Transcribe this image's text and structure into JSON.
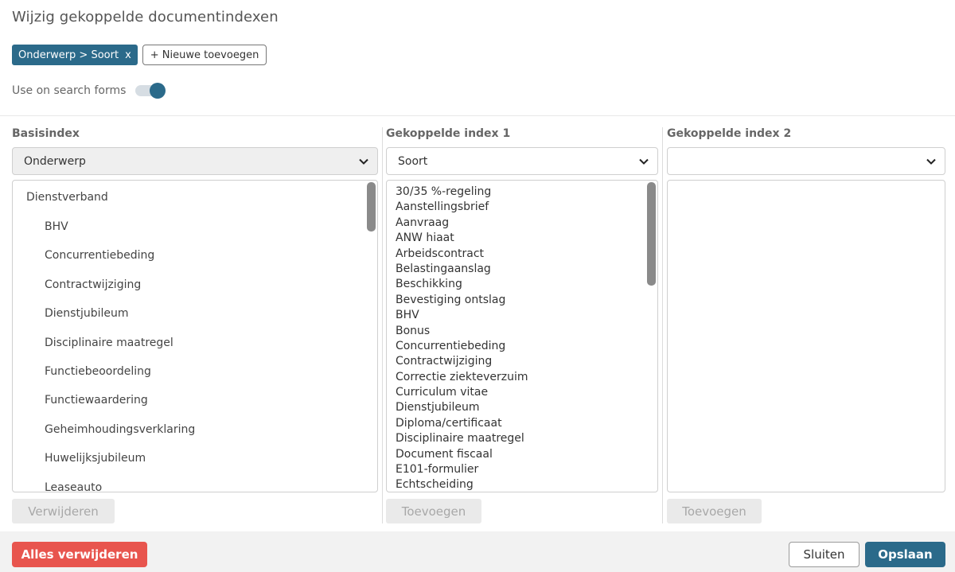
{
  "title": "Wijzig gekoppelde documentindexen",
  "tags": {
    "active_label": "Onderwerp > Soort",
    "remove_symbol": "x",
    "new_label": "+ Nieuwe toevoegen"
  },
  "toggle": {
    "label": "Use on search forms",
    "on": true
  },
  "columns": {
    "base": {
      "label": "Basisindex",
      "selected": "Onderwerp",
      "parent": "Dienstverband",
      "items": [
        "BHV",
        "Concurrentiebeding",
        "Contractwijziging",
        "Dienstjubileum",
        "Disciplinaire maatregel",
        "Functiebeoordeling",
        "Functiewaardering",
        "Geheimhoudingsverklaring",
        "Huwelijksjubileum",
        "Leaseauto"
      ],
      "button": "Verwijderen"
    },
    "linked1": {
      "label": "Gekoppelde index 1",
      "selected": "Soort",
      "items": [
        "30/35 %-regeling",
        "Aanstellingsbrief",
        "Aanvraag",
        "ANW hiaat",
        "Arbeidscontract",
        "Belastingaanslag",
        "Beschikking",
        "Bevestiging ontslag",
        "BHV",
        "Bonus",
        "Concurrentiebeding",
        "Contractwijziging",
        "Correctie ziekteverzuim",
        "Curriculum vitae",
        "Dienstjubileum",
        "Diploma/certificaat",
        "Disciplinaire maatregel",
        "Document fiscaal",
        "E101-formulier",
        "Echtscheiding"
      ],
      "button": "Toevoegen"
    },
    "linked2": {
      "label": "Gekoppelde index 2",
      "selected": "",
      "button": "Toevoegen"
    }
  },
  "footer": {
    "delete_all": "Alles verwijderen",
    "close": "Sluiten",
    "save": "Opslaan"
  },
  "colors": {
    "primary": "#2b6a8a",
    "danger": "#e8554e"
  }
}
